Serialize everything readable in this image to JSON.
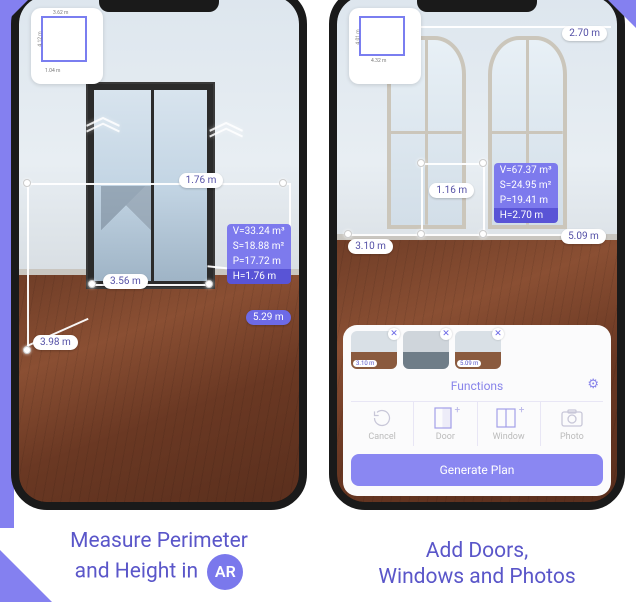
{
  "left": {
    "floorplan": {
      "top_label": "3.62 m",
      "left_label": "4.12 m",
      "small_label": "1.04 m"
    },
    "measurements": {
      "height_pill": "1.76 m",
      "width_pill": "3.56 m",
      "diag_pill": "3.98 m",
      "side_pill": "5.29 m"
    },
    "stats": {
      "v": "V=33.24 m³",
      "s": "S=18.88 m²",
      "p": "P=17.72 m",
      "h": "H=1.76 m"
    },
    "caption_line1": "Measure Perimeter",
    "caption_line2": "and Height in",
    "ar_badge": "AR"
  },
  "right": {
    "height_pill_top": "2.70 m",
    "floorplan": {
      "top_label": "4.32 m",
      "left_label": "4.01 m"
    },
    "measurements": {
      "door_pill": "1.16 m",
      "left_floor_pill": "3.10 m",
      "right_floor_pill": "5.09 m"
    },
    "stats": {
      "v": "V=67.37 m³",
      "s": "S=24.95 m²",
      "p": "P=19.41 m",
      "h": "H=2.70 m"
    },
    "thumbs": [
      {
        "label": "3.10 m"
      },
      {
        "label": ""
      },
      {
        "label": "5.09 m"
      }
    ],
    "functions_label": "Functions",
    "buttons": {
      "cancel": "Cancel",
      "door": "Door",
      "window": "Window",
      "photo": "Photo"
    },
    "generate_plan": "Generate Plan",
    "caption_line1": "Add Doors,",
    "caption_line2": "Windows and Photos"
  }
}
